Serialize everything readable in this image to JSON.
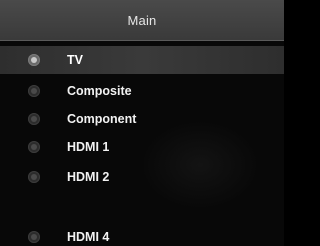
{
  "header": {
    "title": "Main"
  },
  "menu": {
    "items": [
      {
        "label": "TV",
        "icon": "radio-icon",
        "selected": true
      },
      {
        "label": "Composite",
        "icon": "radio-icon",
        "selected": false
      },
      {
        "label": "Component",
        "icon": "radio-icon",
        "selected": false
      },
      {
        "label": "HDMI 1",
        "icon": "radio-icon",
        "selected": false
      },
      {
        "label": "HDMI 2",
        "icon": "radio-icon",
        "selected": false
      },
      {
        "label": "HDMI 4",
        "icon": "radio-icon",
        "selected": false
      }
    ]
  },
  "colors": {
    "background": "#080808",
    "header": "#3e3e3e",
    "selected_row": "#363636",
    "text": "#f2f2f2"
  }
}
